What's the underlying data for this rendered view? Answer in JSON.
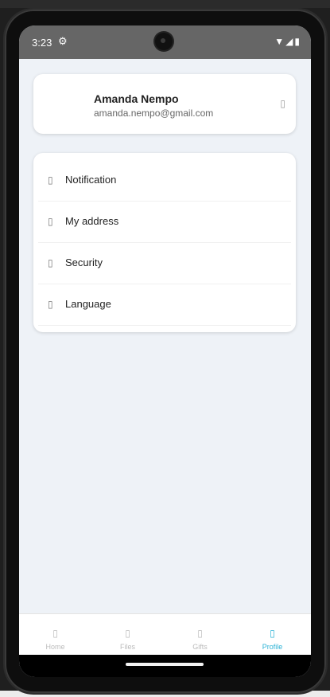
{
  "status": {
    "time": "3:23",
    "settings_icon": "gear-icon",
    "right_icons": "▼◢▮"
  },
  "profile": {
    "name": "Amanda Nempo",
    "email": "amanda.nempo@gmail.com",
    "edit_icon": "edit-icon"
  },
  "menu": {
    "items": [
      {
        "label": "Notification",
        "icon": "bell-icon"
      },
      {
        "label": "My address",
        "icon": "location-icon"
      },
      {
        "label": "Security",
        "icon": "shield-icon"
      },
      {
        "label": "Language",
        "icon": "globe-icon"
      }
    ]
  },
  "nav": {
    "items": [
      {
        "label": "Home",
        "icon": "home-icon"
      },
      {
        "label": "Files",
        "icon": "file-icon"
      },
      {
        "label": "Gifts",
        "icon": "gift-icon"
      },
      {
        "label": "Profile",
        "icon": "profile-icon"
      }
    ],
    "active_color": "#2db3d6",
    "inactive_color": "#bbbbbb"
  },
  "icon_glyph": "▯"
}
